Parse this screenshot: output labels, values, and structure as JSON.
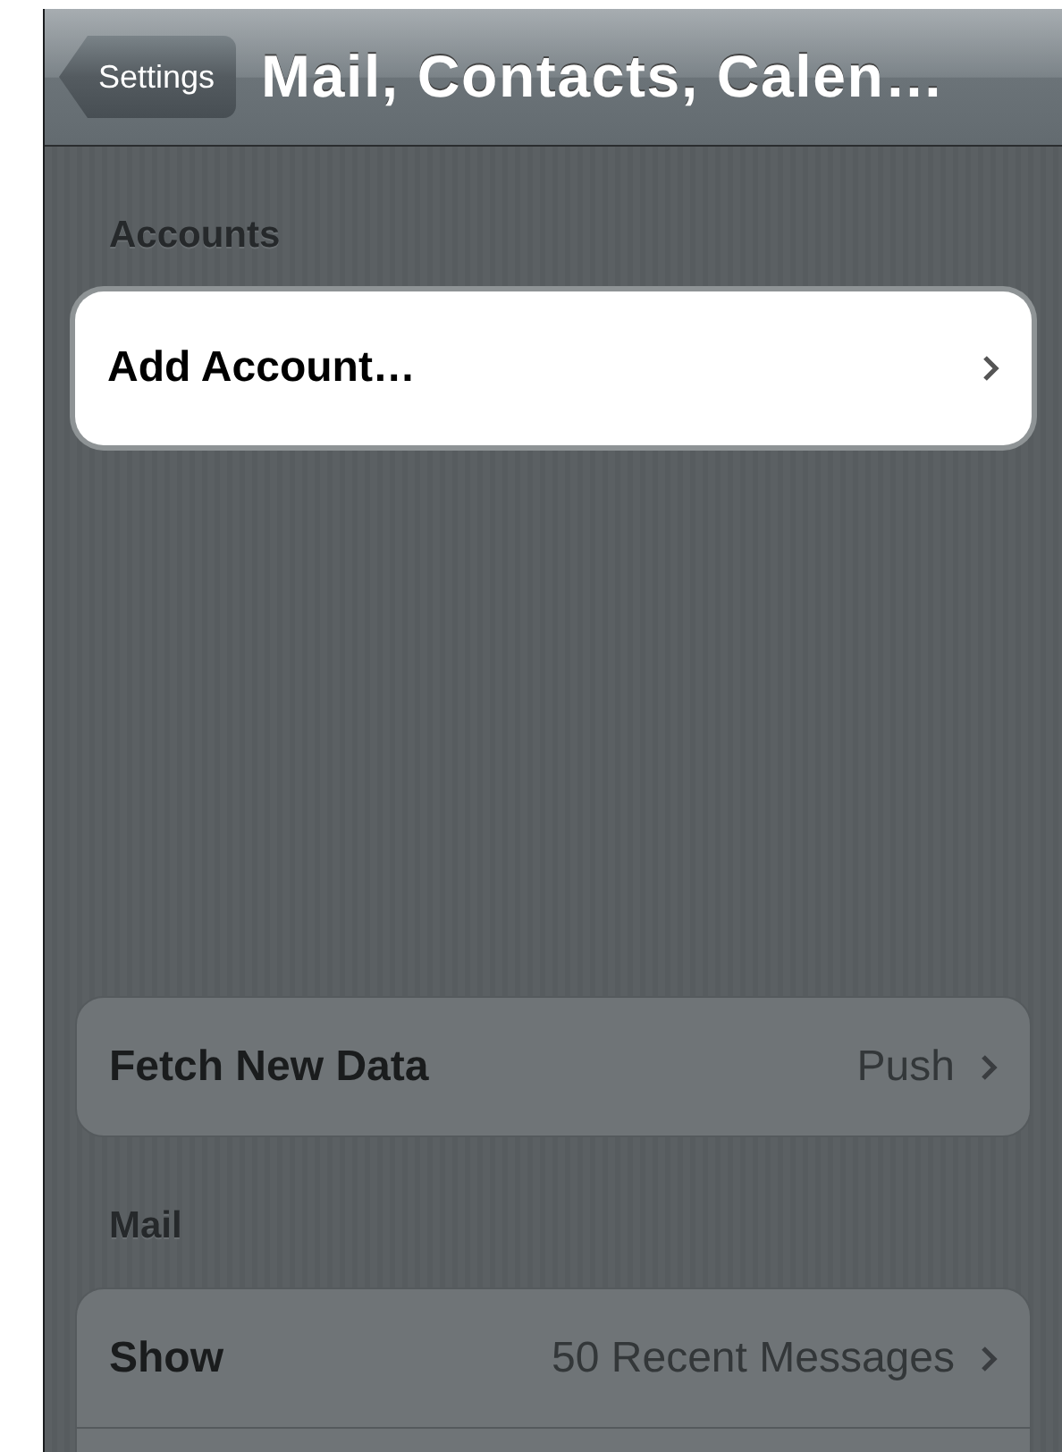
{
  "nav_bar": {
    "back_button": "Settings",
    "title": "Mail, Contacts, Calen…"
  },
  "sections": [
    {
      "header": "Accounts",
      "rows": [
        {
          "label": "Add Account…",
          "highlighted": true
        }
      ]
    },
    {
      "rows": [
        {
          "label": "Fetch New Data",
          "value": "Push",
          "highlighted": false
        }
      ]
    },
    {
      "header": "Mail",
      "rows": [
        {
          "label": "Show",
          "value": "50 Recent Messages",
          "highlighted": false
        }
      ],
      "cut_off_row": true
    }
  ]
}
